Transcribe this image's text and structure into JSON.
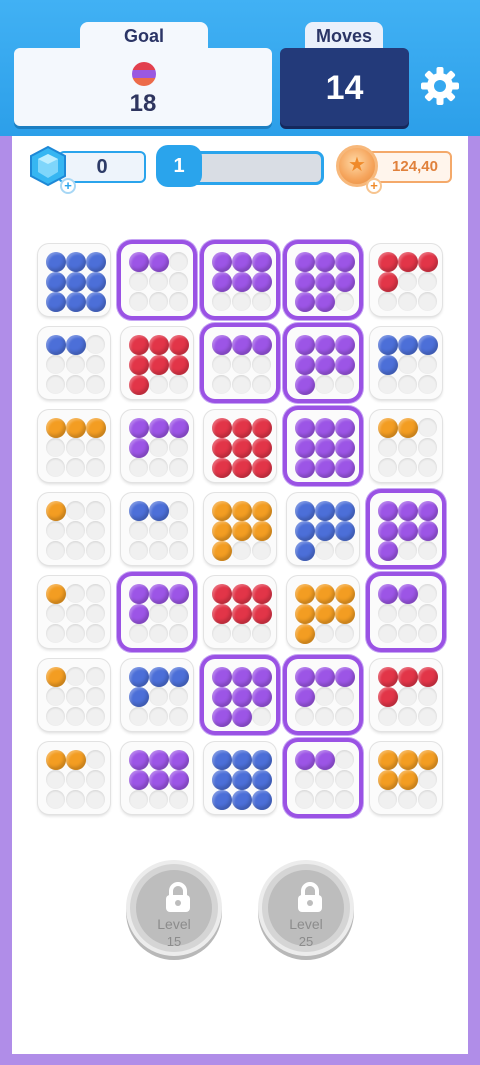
{
  "header": {
    "goal_label": "Goal",
    "goal_value": "18",
    "moves_label": "Moves",
    "moves_value": "14",
    "settings_icon": "gear-icon"
  },
  "resources": {
    "gems": "0",
    "level": "1",
    "level_progress": 0,
    "coins": "124,40"
  },
  "colors": {
    "blue": "#4c6fd8",
    "purple": "#9c55e6",
    "red": "#e23548",
    "orange": "#f39d22",
    "selected_border": "#9a52e4"
  },
  "board": {
    "rows": [
      [
        {
          "c": "blue",
          "n": 9,
          "s": false
        },
        {
          "c": "purple",
          "n": 2,
          "s": true
        },
        {
          "c": "purple",
          "n": 6,
          "s": true
        },
        {
          "c": "purple",
          "n": 8,
          "s": true
        },
        {
          "c": "red",
          "n": 4,
          "s": false
        }
      ],
      [
        {
          "c": "blue",
          "n": 2,
          "s": false
        },
        {
          "c": "red",
          "n": 7,
          "s": false
        },
        {
          "c": "purple",
          "n": 3,
          "s": true
        },
        {
          "c": "purple",
          "n": 7,
          "s": true
        },
        {
          "c": "blue",
          "n": 4,
          "s": false
        }
      ],
      [
        {
          "c": "orange",
          "n": 3,
          "s": false
        },
        {
          "c": "purple",
          "n": 4,
          "s": false
        },
        {
          "c": "red",
          "n": 9,
          "s": false
        },
        {
          "c": "purple",
          "n": 9,
          "s": true
        },
        {
          "c": "orange",
          "n": 2,
          "s": false
        }
      ],
      [
        {
          "c": "orange",
          "n": 1,
          "s": false
        },
        {
          "c": "blue",
          "n": 2,
          "s": false
        },
        {
          "c": "orange",
          "n": 7,
          "s": false
        },
        {
          "c": "blue",
          "n": 7,
          "s": false
        },
        {
          "c": "purple",
          "n": 7,
          "s": true
        }
      ],
      [
        {
          "c": "orange",
          "n": 1,
          "s": false
        },
        {
          "c": "purple",
          "n": 4,
          "s": true
        },
        {
          "c": "red",
          "n": 6,
          "s": false
        },
        {
          "c": "orange",
          "n": 7,
          "s": false
        },
        {
          "c": "purple",
          "n": 2,
          "s": true
        }
      ],
      [
        {
          "c": "orange",
          "n": 1,
          "s": false
        },
        {
          "c": "blue",
          "n": 4,
          "s": false
        },
        {
          "c": "purple",
          "n": 8,
          "s": true
        },
        {
          "c": "purple",
          "n": 4,
          "s": true
        },
        {
          "c": "red",
          "n": 4,
          "s": false
        }
      ],
      [
        {
          "c": "orange",
          "n": 2,
          "s": false
        },
        {
          "c": "purple",
          "n": 6,
          "s": false
        },
        {
          "c": "blue",
          "n": 9,
          "s": false
        },
        {
          "c": "purple",
          "n": 2,
          "s": true
        },
        {
          "c": "orange",
          "n": 5,
          "s": false
        }
      ]
    ]
  },
  "locked_slots": [
    {
      "label": "Level",
      "value": "15",
      "icon": "lock-icon"
    },
    {
      "label": "Level",
      "value": "25",
      "icon": "lock-icon"
    }
  ]
}
